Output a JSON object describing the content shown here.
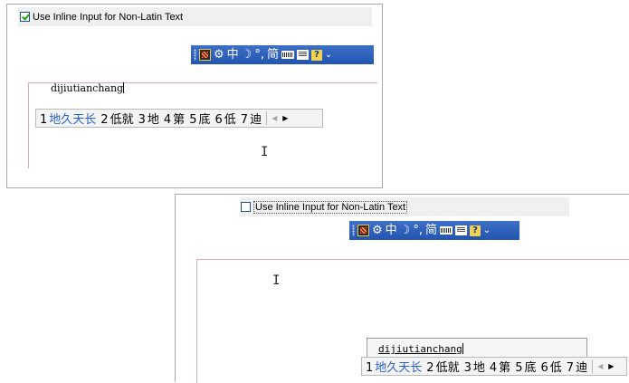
{
  "top": {
    "checkbox_label": "Use Inline Input for Non-Latin Text",
    "checkbox_checked": true,
    "ime_bar": {
      "mode_char": "中",
      "punct_symbol": "°,",
      "script_char": "简",
      "help_char": "?"
    },
    "composition_text": "dijiutianchang",
    "candidates": [
      {
        "num": "1",
        "word": "地久天长",
        "selected": true
      },
      {
        "num": "2",
        "word": "低就",
        "selected": false
      },
      {
        "num": "3",
        "word": "地",
        "selected": false
      },
      {
        "num": "4",
        "word": "第",
        "selected": false
      },
      {
        "num": "5",
        "word": "底",
        "selected": false
      },
      {
        "num": "6",
        "word": "低",
        "selected": false
      },
      {
        "num": "7",
        "word": "迪",
        "selected": false
      }
    ]
  },
  "bottom": {
    "checkbox_label": "Use Inline Input for Non-Latin Text",
    "checkbox_checked": false,
    "ime_bar": {
      "mode_char": "中",
      "punct_symbol": "°,",
      "script_char": "简",
      "help_char": "?"
    },
    "composition_text": "dijiutianchang",
    "candidates": [
      {
        "num": "1",
        "word": "地久天长",
        "selected": true
      },
      {
        "num": "2",
        "word": "低就",
        "selected": false
      },
      {
        "num": "3",
        "word": "地",
        "selected": false
      },
      {
        "num": "4",
        "word": "第",
        "selected": false
      },
      {
        "num": "5",
        "word": "底",
        "selected": false
      },
      {
        "num": "6",
        "word": "低",
        "selected": false
      },
      {
        "num": "7",
        "word": "迪",
        "selected": false
      }
    ]
  },
  "icons": {
    "prev": "◀",
    "next": "▶",
    "moon": "☽",
    "settings": "⚙",
    "more": "⌄",
    "ibeam": "I"
  }
}
